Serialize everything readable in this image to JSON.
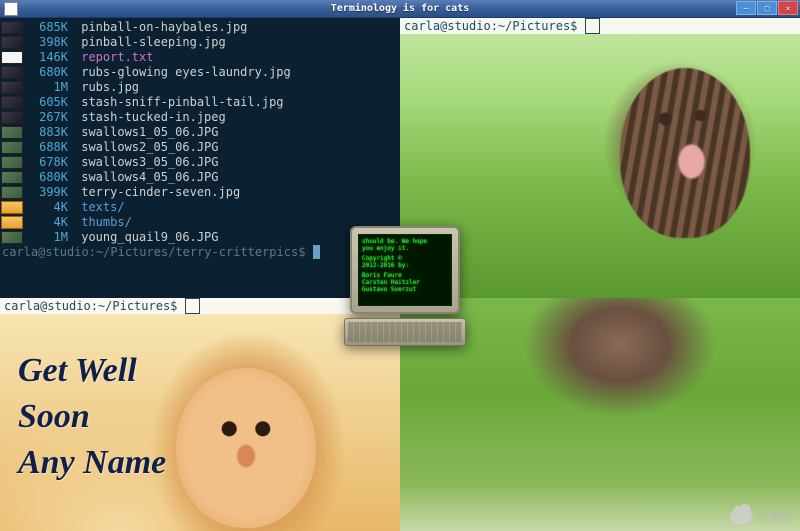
{
  "window": {
    "title": "Terminology is for cats",
    "buttons": {
      "min": "—",
      "max": "▢",
      "close": "✕"
    }
  },
  "pane_tl": {
    "files": [
      {
        "size": "685K",
        "name": "pinball-on-haybales.jpg",
        "kind": "img",
        "thumb": "dark"
      },
      {
        "size": "398K",
        "name": "pinball-sleeping.jpg",
        "kind": "img",
        "thumb": "dark"
      },
      {
        "size": "146K",
        "name": "report.txt",
        "kind": "txt",
        "thumb": "doc"
      },
      {
        "size": "680K",
        "name": "rubs-glowing eyes-laundry.jpg",
        "kind": "img",
        "thumb": "dark"
      },
      {
        "size": "1M",
        "name": "rubs.jpg",
        "kind": "img",
        "thumb": "dark"
      },
      {
        "size": "605K",
        "name": "stash-sniff-pinball-tail.jpg",
        "kind": "img",
        "thumb": "dark"
      },
      {
        "size": "267K",
        "name": "stash-tucked-in.jpeg",
        "kind": "img",
        "thumb": "dark"
      },
      {
        "size": "883K",
        "name": "swallows1_05_06.JPG",
        "kind": "img",
        "thumb": "img"
      },
      {
        "size": "688K",
        "name": "swallows2_05_06.JPG",
        "kind": "img",
        "thumb": "img"
      },
      {
        "size": "678K",
        "name": "swallows3_05_06.JPG",
        "kind": "img",
        "thumb": "img"
      },
      {
        "size": "680K",
        "name": "swallows4_05_06.JPG",
        "kind": "img",
        "thumb": "img"
      },
      {
        "size": "399K",
        "name": "terry-cinder-seven.jpg",
        "kind": "img",
        "thumb": "img"
      },
      {
        "size": "4K",
        "name": "texts/",
        "kind": "dir",
        "thumb": "folder"
      },
      {
        "size": "4K",
        "name": "thumbs/",
        "kind": "dir",
        "thumb": "folder"
      },
      {
        "size": "1M",
        "name": "young_quail9_06.JPG",
        "kind": "img",
        "thumb": "img"
      }
    ],
    "prompt": "carla@studio:~/Pictures/terry-critterpics$"
  },
  "pane_tr": {
    "prompt": "carla@studio:~/Pictures$ "
  },
  "pane_bl": {
    "prompt": "carla@studio:~/Pictures$ ",
    "card_line1": "Get Well",
    "card_line2": "Soon",
    "card_line3": "Any Name"
  },
  "about": {
    "l1": "should be. We hope",
    "l2": "you enjoy it.",
    "l3": "Copyright ©",
    "l4": "2012-2016 by:",
    "l5": "Boris Faure",
    "l6": "Carsten Haitzler",
    "l7": "Gustavo Sverzut"
  },
  "watermark": "亿速云"
}
